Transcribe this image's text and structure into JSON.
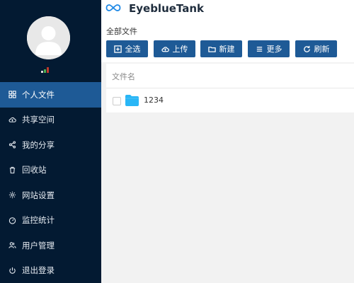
{
  "sidebar": {
    "user_colors": [
      "#d9d9d9",
      "#4caf50",
      "#c0392b"
    ],
    "items": [
      {
        "label": "个人文件",
        "icon": "grid-icon",
        "active": true
      },
      {
        "label": "共享空间",
        "icon": "cloud-icon",
        "active": false
      },
      {
        "label": "我的分享",
        "icon": "share-icon",
        "active": false
      },
      {
        "label": "回收站",
        "icon": "trash-icon",
        "active": false
      },
      {
        "label": "网站设置",
        "icon": "gear-icon",
        "active": false
      },
      {
        "label": "监控统计",
        "icon": "dashboard-icon",
        "active": false
      },
      {
        "label": "用户管理",
        "icon": "users-icon",
        "active": false
      },
      {
        "label": "退出登录",
        "icon": "power-icon",
        "active": false
      }
    ]
  },
  "header": {
    "brand": "EyeblueTank",
    "logo_icon": "infinity-logo-icon"
  },
  "main": {
    "breadcrumb": "全部文件",
    "toolbar": {
      "select_all": "全选",
      "upload": "上传",
      "new": "新建",
      "more": "更多",
      "refresh": "刷新"
    },
    "list": {
      "column_name": "文件名",
      "items": [
        {
          "name": "1234",
          "type": "folder"
        }
      ]
    }
  },
  "colors": {
    "sidebar_bg": "#031a32",
    "accent": "#1e5a96",
    "folder": "#29b6f6"
  }
}
